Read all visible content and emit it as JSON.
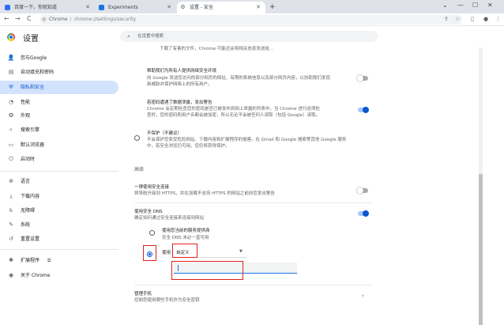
{
  "tabs": [
    {
      "label": "百度一下，你就知道",
      "fav_color": "#2f6df5"
    },
    {
      "label": "Experiments",
      "fav_color": "#1a73e8"
    },
    {
      "label": "设置 - 安全",
      "fav_color": "#5f6368"
    }
  ],
  "new_tab": "+",
  "toolbar": {
    "back": "←",
    "forward": "→",
    "reload": "C",
    "site_label": "Chrome",
    "url": "chrome://settings/security"
  },
  "header": {
    "title": "设置",
    "search_placeholder": "在设置中搜索"
  },
  "sidebar": {
    "items": [
      {
        "label": "您与Google",
        "icon": "person-icon"
      },
      {
        "label": "自动填充和密码",
        "icon": "clipboard-icon"
      },
      {
        "label": "隐私和安全",
        "icon": "shield-icon"
      },
      {
        "label": "性能",
        "icon": "gauge-icon"
      },
      {
        "label": "外观",
        "icon": "palette-icon"
      },
      {
        "label": "搜索引擎",
        "icon": "search-icon"
      },
      {
        "label": "默认浏览器",
        "icon": "browser-icon"
      },
      {
        "label": "启动时",
        "icon": "power-icon"
      },
      {
        "label": "语言",
        "icon": "globe-icon"
      },
      {
        "label": "下载内容",
        "icon": "download-icon"
      },
      {
        "label": "无障碍",
        "icon": "accessibility-icon"
      },
      {
        "label": "系统",
        "icon": "wrench-icon"
      },
      {
        "label": "重置设置",
        "icon": "reset-icon"
      },
      {
        "label": "扩展程序",
        "icon": "puzzle-icon"
      },
      {
        "label": "关于 Chrome",
        "icon": "chrome-icon"
      }
    ],
    "selected_index": 2
  },
  "content": {
    "top_fragment": "下载了有害的文件，Chrome 可能还会将相关信息发送给…",
    "block1": {
      "title": "帮助我们为所有人提供网络安全环境",
      "desc1": "向 Google 发送您访问的部分网页的网址、有限的系统信息以及部分网页内容，以协助我们发现",
      "desc2": "新威胁并保护网络上的所有用户。",
      "toggle": false
    },
    "block2": {
      "title": "若密码遭遇了数据泄露，发出警告",
      "desc1": "Chrome 会定期检查您的密码是否已被发布到网上泄露的列表中。当 Chrome 进行这项检",
      "desc2": "查时，您的密码和用户名都会被加密，所以无论不会被任何人读取（包括 Google）读取。",
      "toggle": true
    },
    "block3": {
      "title": "不保护（不建议）",
      "desc1": "不会保护您免受危险网站、下载内容和扩展程序的侵害。在 Gmail 和 Google 搜索等其他 Google 服务",
      "desc2": "中，若安全浏览仍可用，您仍将获得保护。"
    },
    "advanced_heading": "高级",
    "https": {
      "title": "一律使用安全连接",
      "desc": "将导航升级到 HTTPS，并在加载不支持 HTTPS 的网站之前向您发出警告",
      "toggle": false
    },
    "dns": {
      "title": "使用安全 DNS",
      "desc": "确定如何通过安全连接来连接到网站",
      "toggle": true,
      "option1_title": "使用您当前的服务提供商",
      "option1_desc": "安全 DNS 未必一直可用",
      "option2_label": "使用",
      "provider_value": "自定义",
      "custom_input_value": ""
    },
    "phones": {
      "title": "管理手机",
      "desc": "控制您使用哪些手机作为安全密钥"
    }
  }
}
